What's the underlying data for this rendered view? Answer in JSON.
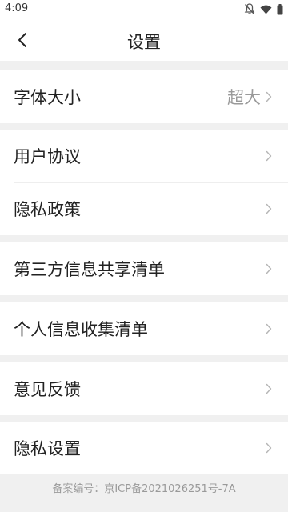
{
  "status_bar": {
    "time": "4:09"
  },
  "nav": {
    "title": "设置"
  },
  "sections": [
    {
      "rows": [
        {
          "label": "字体大小",
          "value": "超大"
        }
      ]
    },
    {
      "rows": [
        {
          "label": "用户协议"
        },
        {
          "label": "隐私政策"
        }
      ]
    },
    {
      "rows": [
        {
          "label": "第三方信息共享清单"
        }
      ]
    },
    {
      "rows": [
        {
          "label": "个人信息收集清单"
        }
      ]
    },
    {
      "rows": [
        {
          "label": "意见反馈"
        }
      ]
    },
    {
      "rows": [
        {
          "label": "隐私设置"
        }
      ]
    }
  ],
  "footer": {
    "text": "备案编号：京ICP备2021026251号-7A"
  },
  "icons": {
    "status": [
      "notifications-off-icon",
      "wifi-icon",
      "battery-icon"
    ],
    "back": "back-arrow-icon",
    "row": "chevron-right-icon"
  },
  "colors": {
    "background": "#f0f0f0",
    "card": "#ffffff",
    "text": "#222222",
    "secondary": "#9a9a9a"
  }
}
